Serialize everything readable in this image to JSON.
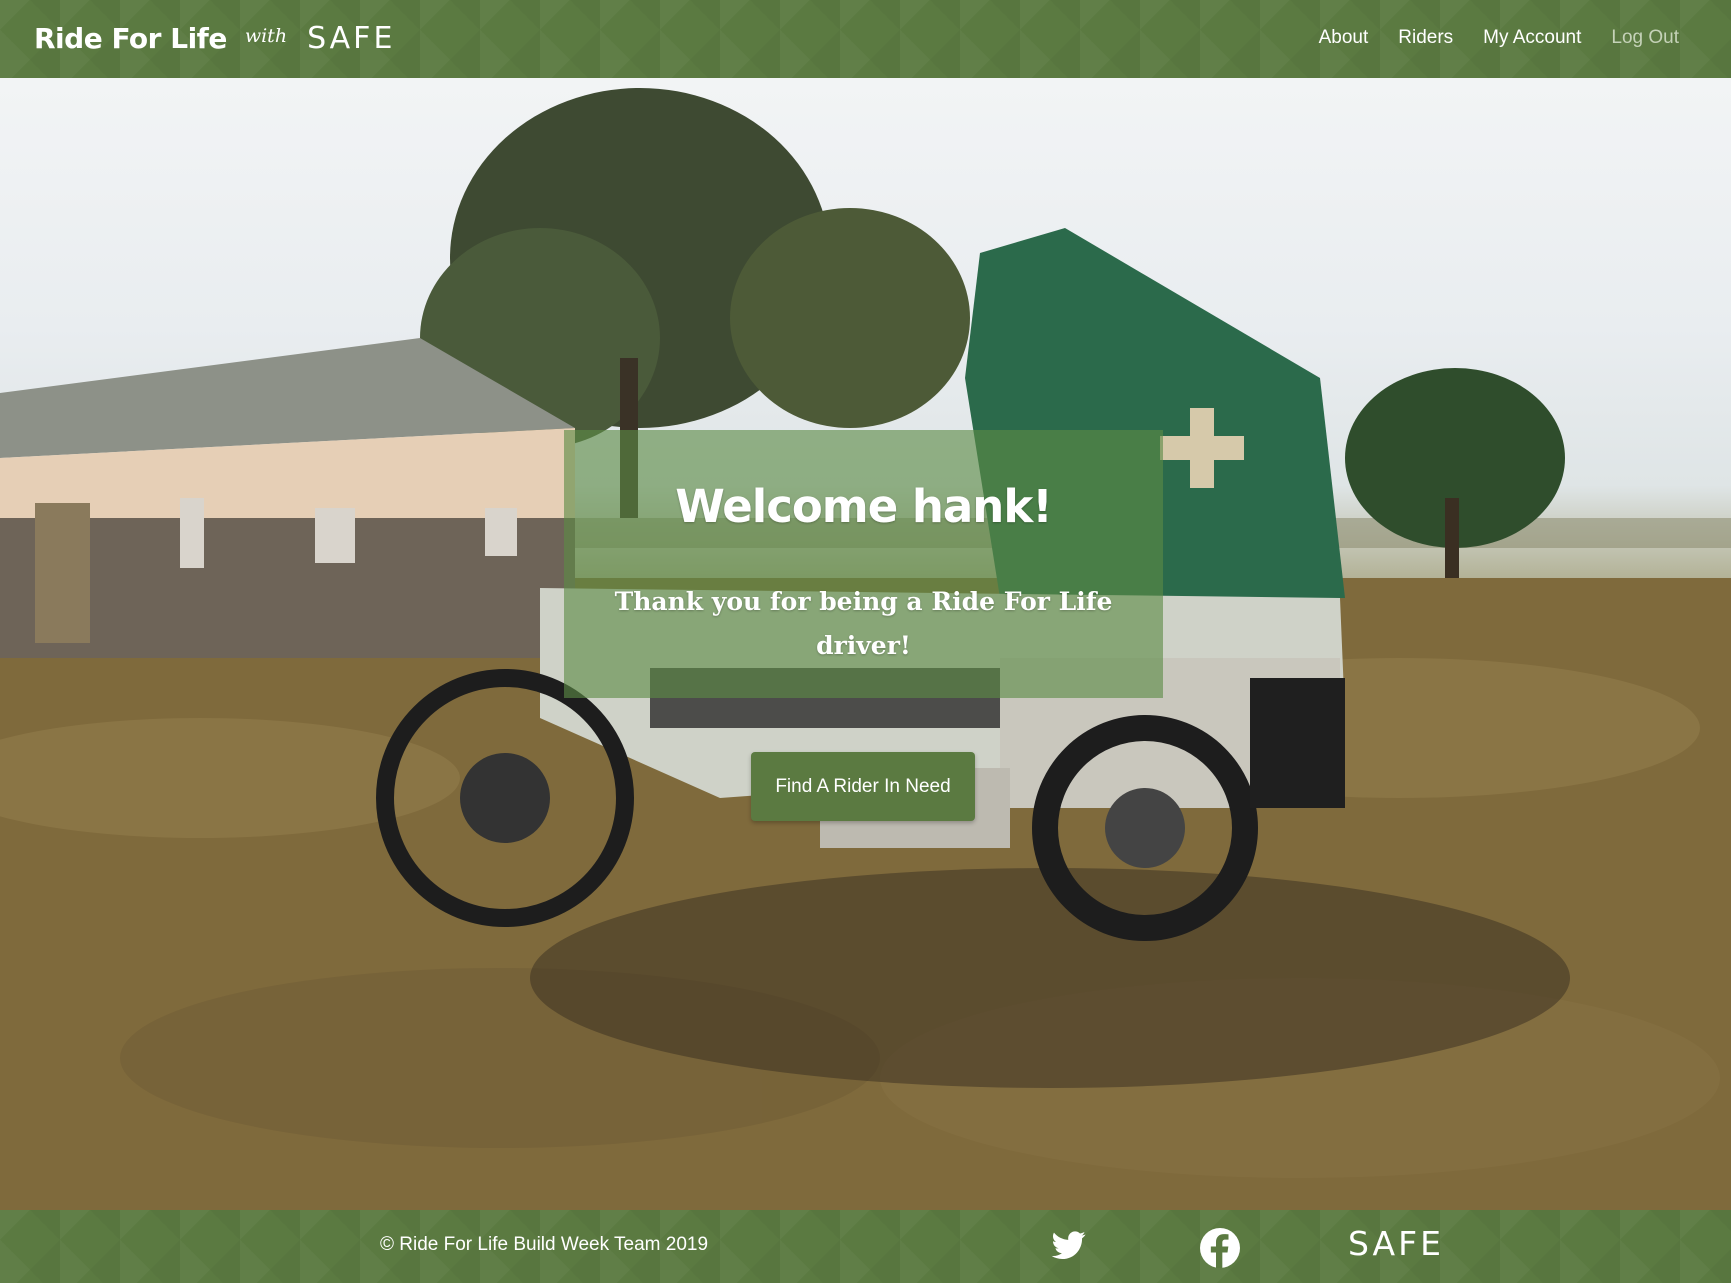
{
  "header": {
    "brand_title": "Ride For Life",
    "brand_with": "with",
    "brand_safe": "SAFE",
    "nav": {
      "about": "About",
      "riders": "Riders",
      "my_account": "My Account",
      "log_out": "Log Out"
    }
  },
  "hero": {
    "welcome_title": "Welcome hank!",
    "welcome_message": "Thank you for being a Ride For Life driver!",
    "cta_label": "Find A Rider In Need"
  },
  "footer": {
    "copyright": "© Ride For Life Build Week Team 2019",
    "twitter_icon": "twitter-icon",
    "facebook_icon": "facebook-icon",
    "safe_logo": "SAFE"
  },
  "colors": {
    "brand_green": "#5b7a41",
    "overlay_green": "#5c8a46",
    "nav_muted": "#c5d2b8"
  }
}
